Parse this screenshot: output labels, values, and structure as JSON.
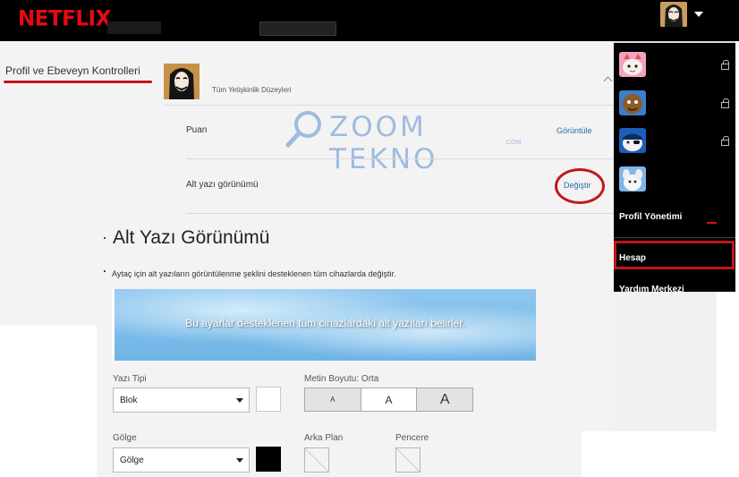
{
  "header": {
    "logo": "NETFLIX"
  },
  "profile_section": {
    "title": "Profil ve Ebeveyn Kontrolleri",
    "maturity_label": "Tüm Yetişkinlik Düzeyleri"
  },
  "settings_rows": [
    {
      "label": "Puan",
      "action": "Görüntüle"
    },
    {
      "label": "Alt yazı görünümü",
      "action": "Değiştir"
    }
  ],
  "watermark": {
    "text": "ZOOM TEKNO",
    "sub": ".COM"
  },
  "subtitle_page": {
    "title": "Alt Yazı Görünümü",
    "description": "Aytaç için alt yazıların görüntülenme şeklini desteklenen tüm cihazlarda değiştir.",
    "preview_text": "Bu ayarlar desteklenen tüm cihazlardaki alt yazıları belirler."
  },
  "controls": {
    "font_label": "Yazı Tipi",
    "font_value": "Blok",
    "size_label": "Metin Boyutu: Orta",
    "size_options": [
      "A",
      "A",
      "A"
    ],
    "shadow_label": "Gölge",
    "shadow_value": "Gölge",
    "background_label": "Arka Plan",
    "window_label": "Pencere"
  },
  "dropdown_menu": {
    "manage_profiles": "Profil Yönetimi",
    "account": "Hesap",
    "help": "Yardım Merkezi"
  },
  "colors": {
    "brand_red": "#e50914",
    "annotation_red": "#c4161c",
    "link_blue": "#2470a8"
  }
}
